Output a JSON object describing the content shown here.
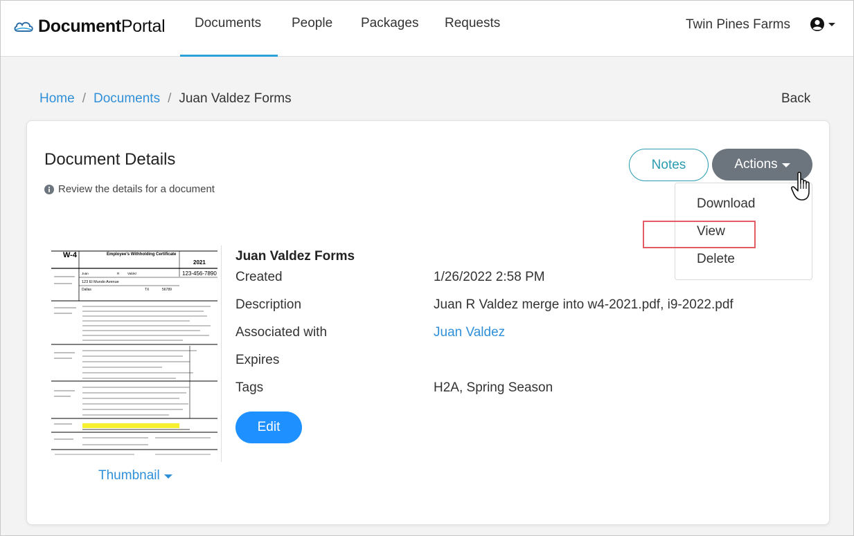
{
  "brand": {
    "bold": "Document",
    "regular": "Portal"
  },
  "nav": {
    "items": [
      "Documents",
      "People",
      "Packages",
      "Requests"
    ],
    "active_index": 0,
    "org_name": "Twin Pines Farms",
    "user_icon": "user-circle-icon"
  },
  "breadcrumb": {
    "home": "Home",
    "documents": "Documents",
    "current": "Juan Valdez Forms",
    "separator": "/"
  },
  "back_label": "Back",
  "card": {
    "title": "Document Details",
    "subtitle": "Review the details for a document",
    "notes_label": "Notes",
    "actions_label": "Actions",
    "dropdown": {
      "items": [
        "Download",
        "View",
        "Delete"
      ],
      "highlighted": "View"
    },
    "thumbnail_label": "Thumbnail",
    "doc_name": "Juan Valdez Forms",
    "details": [
      {
        "label": "Created",
        "value": "1/26/2022 2:58 PM"
      },
      {
        "label": "Description",
        "value": "Juan R Valdez merge into w4-2021.pdf, i9-2022.pdf"
      },
      {
        "label": "Associated with",
        "value": "Juan Valdez",
        "link": true
      },
      {
        "label": "Expires",
        "value": ""
      },
      {
        "label": "Tags",
        "value": "H2A, Spring Season"
      }
    ],
    "edit_label": "Edit"
  },
  "thumbnail_form": {
    "form_id": "W-4",
    "form_title": "Employee's Withholding Certificate",
    "year": "2021",
    "ssn": "123-456-7890",
    "address": "123 El Mundo Avenue",
    "city": "Dallas",
    "state": "TX",
    "zip": "56789",
    "first_name": "Juan",
    "middle_initial": "R",
    "last_name": "Valdez"
  },
  "colors": {
    "accent": "#2aa0d8",
    "link": "#2f8fd8",
    "notes": "#2a9bb0",
    "actions_bg": "#6c757d",
    "edit_bg": "#1e90ff",
    "highlight_box": "#e35b63"
  }
}
